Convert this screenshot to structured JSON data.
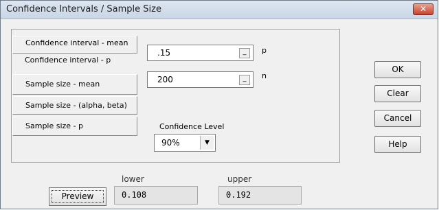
{
  "window": {
    "title": "Confidence Intervals / Sample Size",
    "close_glyph": "✕"
  },
  "modes": [
    {
      "label": "Confidence interval - mean"
    },
    {
      "label": "Confidence interval - p"
    },
    {
      "label": "Sample size - mean"
    },
    {
      "label": "Sample size - (alpha, beta)"
    },
    {
      "label": "Sample size - p"
    }
  ],
  "inputs": {
    "p_value": ".15",
    "p_label": "p",
    "n_value": "200",
    "n_label": "n",
    "spin_glyph": "_"
  },
  "confidence": {
    "label": "Confidence Level",
    "selected": "90%",
    "arrow_glyph": "▼"
  },
  "buttons": {
    "ok": "OK",
    "clear": "Clear",
    "cancel": "Cancel",
    "help": "Help",
    "preview": "Preview"
  },
  "results": {
    "lower_label": "lower",
    "lower_value": "0.108",
    "upper_label": "upper",
    "upper_value": "0.192"
  }
}
